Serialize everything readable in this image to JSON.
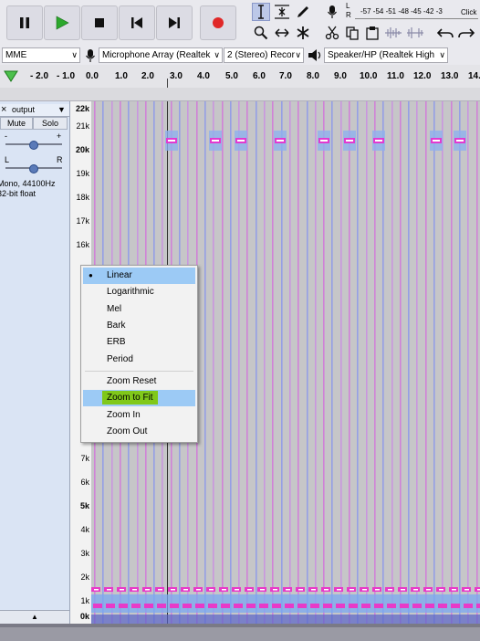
{
  "meter": {
    "lr_top": "L",
    "lr_bottom": "R",
    "scale": "-57 -54 -51 -48 -45 -42 -3",
    "click_text": "Click"
  },
  "devices": {
    "host": "MME",
    "mic": "Microphone Array (Realtek",
    "channels": "2 (Stereo) Recor",
    "speaker": "Speaker/HP (Realtek High"
  },
  "ruler": {
    "ticks": [
      "- 2.0",
      "- 1.0",
      "0.0",
      "1.0",
      "2.0",
      "3.0",
      "4.0",
      "5.0",
      "6.0",
      "7.0",
      "8.0",
      "9.0",
      "10.0",
      "11.0",
      "12.0",
      "13.0",
      "14."
    ]
  },
  "track": {
    "name": "output",
    "close": "×",
    "mute": "Mute",
    "solo": "Solo",
    "gain_minus": "-",
    "gain_plus": "+",
    "pan_l": "L",
    "pan_r": "R",
    "info_line1": "Mono, 44100Hz",
    "info_line2": "32-bit float"
  },
  "vscale_labels": [
    "22k",
    "21k",
    "20k",
    "19k",
    "18k",
    "17k",
    "16k",
    "15",
    "14",
    "13",
    "12",
    "11",
    "10",
    "9",
    "8",
    "7k",
    "6k",
    "5k",
    "4k",
    "3k",
    "2k",
    "1k",
    "0k"
  ],
  "menu": {
    "items": [
      "Linear",
      "Logarithmic",
      "Mel",
      "Bark",
      "ERB",
      "Period"
    ],
    "zoom": [
      "Zoom Reset",
      "Zoom to Fit",
      "Zoom In",
      "Zoom Out"
    ],
    "checked_index": 0,
    "highlighted": "Zoom to Fit",
    "check_glyph": "●"
  },
  "colors": {
    "accent_hover": "#9ccaf5",
    "highlight_green": "#80c81a",
    "record_red": "#e02828",
    "play_green": "#2ca82c"
  }
}
